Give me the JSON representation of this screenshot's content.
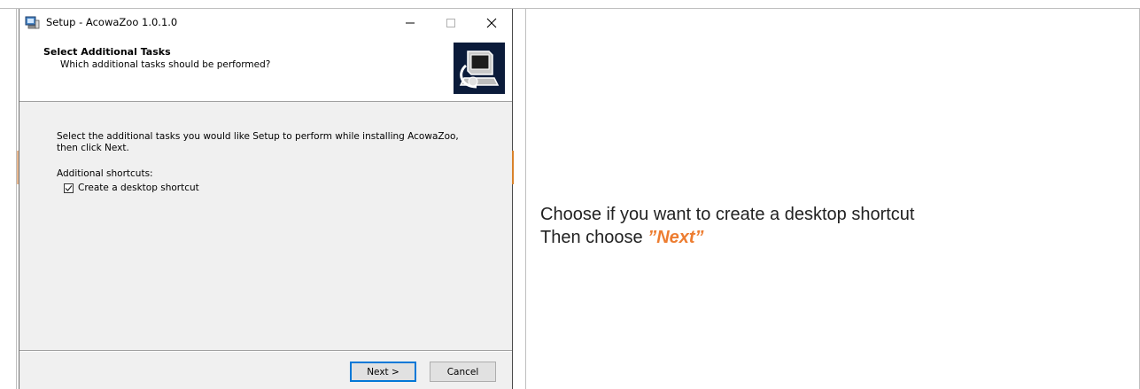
{
  "window": {
    "title": "Setup - AcowaZoo 1.0.1.0",
    "controls": {
      "minimize": "–",
      "maximize": "☐",
      "close": "✕"
    }
  },
  "header": {
    "title": "Select Additional Tasks",
    "subtitle": "Which additional tasks should be performed?"
  },
  "body": {
    "description": "Select the additional tasks you would like Setup to perform while installing AcowaZoo, then click Next.",
    "group_label": "Additional shortcuts:",
    "checkbox": {
      "label": "Create a desktop shortcut",
      "checked": true
    }
  },
  "buttons": {
    "next": "Next >",
    "cancel": "Cancel"
  },
  "instructions": {
    "line1": "Choose if you want to create a desktop shortcut",
    "line2_prefix": "Then choose ",
    "line2_emphasis": "”Next”"
  },
  "colors": {
    "accent": "#0078d7",
    "emphasis": "#ed7d31",
    "header_image": "#0b1b3a"
  },
  "icons": {
    "app": "installer-computer-icon",
    "header": "computer-install-icon",
    "checkbox": "checkmark-icon"
  }
}
